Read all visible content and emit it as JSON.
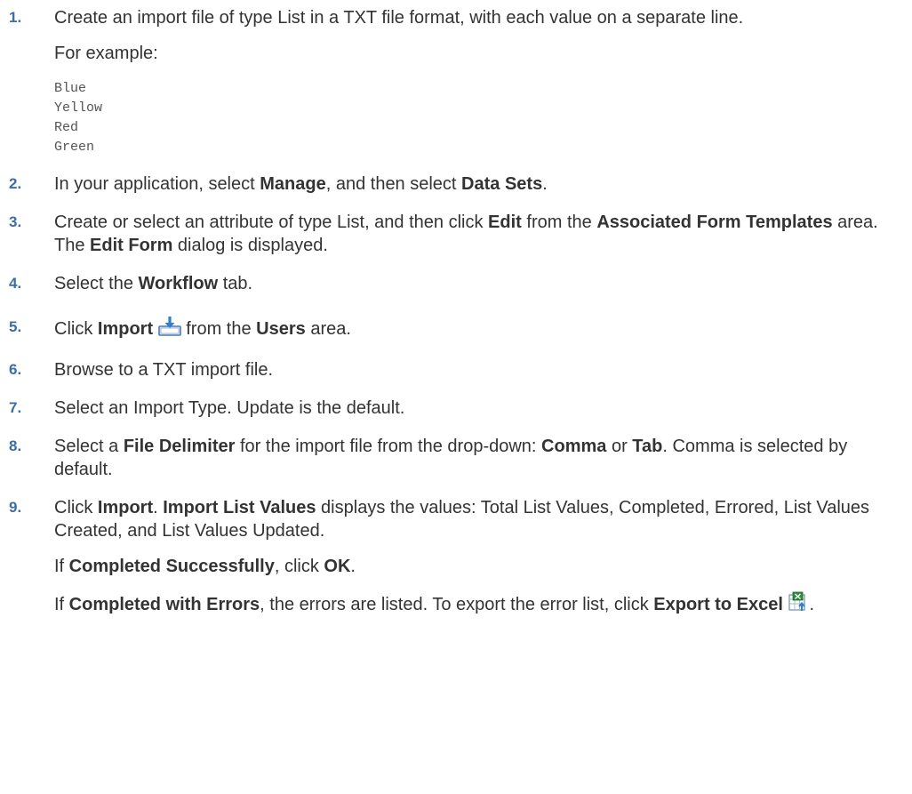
{
  "steps": [
    {
      "num": "1.",
      "text": "Create an import file of type List in a TXT file format, with each value on a separate line.",
      "sub_label": "For example:",
      "code": [
        "Blue",
        "Yellow",
        "Red",
        "Green"
      ]
    },
    {
      "num": "2.",
      "t1": "In your application, select ",
      "b1": "Manage",
      "t2": ", and then select ",
      "b2": "Data Sets",
      "t3": "."
    },
    {
      "num": "3.",
      "t1": "Create or select an attribute of type List, and then click ",
      "b1": "Edit",
      "t2": " from the ",
      "b2": "Associated Form Templates",
      "t3": " area. The ",
      "b3": "Edit Form",
      "t4": " dialog is displayed."
    },
    {
      "num": "4.",
      "t1": "Select the ",
      "b1": "Workflow",
      "t2": " tab."
    },
    {
      "num": "5.",
      "t1": "Click ",
      "b1": "Import",
      "t2": " from the ",
      "b2": "Users",
      "t3": " area.",
      "icon": "import-icon"
    },
    {
      "num": "6.",
      "text": "Browse to a TXT import file."
    },
    {
      "num": "7.",
      "text": "Select an Import Type. Update is the default."
    },
    {
      "num": "8.",
      "t1": "Select a ",
      "b1": "File Delimiter",
      "t2": " for the import file from the drop-down: ",
      "b2": "Comma",
      "t3": " or ",
      "b3": "Tab",
      "t4": ". Comma is selected by default."
    },
    {
      "num": "9.",
      "t1": "Click ",
      "b1": "Import",
      "t2": ". ",
      "b2": "Import List Values",
      "t3": " displays the values: Total List Values, Completed, Errored, List Values Created, and List Values Updated.",
      "p2": {
        "t1": "If ",
        "b1": "Completed Successfully",
        "t2": ", click ",
        "b2": "OK",
        "t3": "."
      },
      "p3": {
        "t1": "If ",
        "b1": "Completed with Errors",
        "t2": ", the errors are listed. To export the error list, click ",
        "b2": "Export to Excel",
        "t3": ".",
        "icon": "export-to-excel-icon"
      }
    }
  ]
}
